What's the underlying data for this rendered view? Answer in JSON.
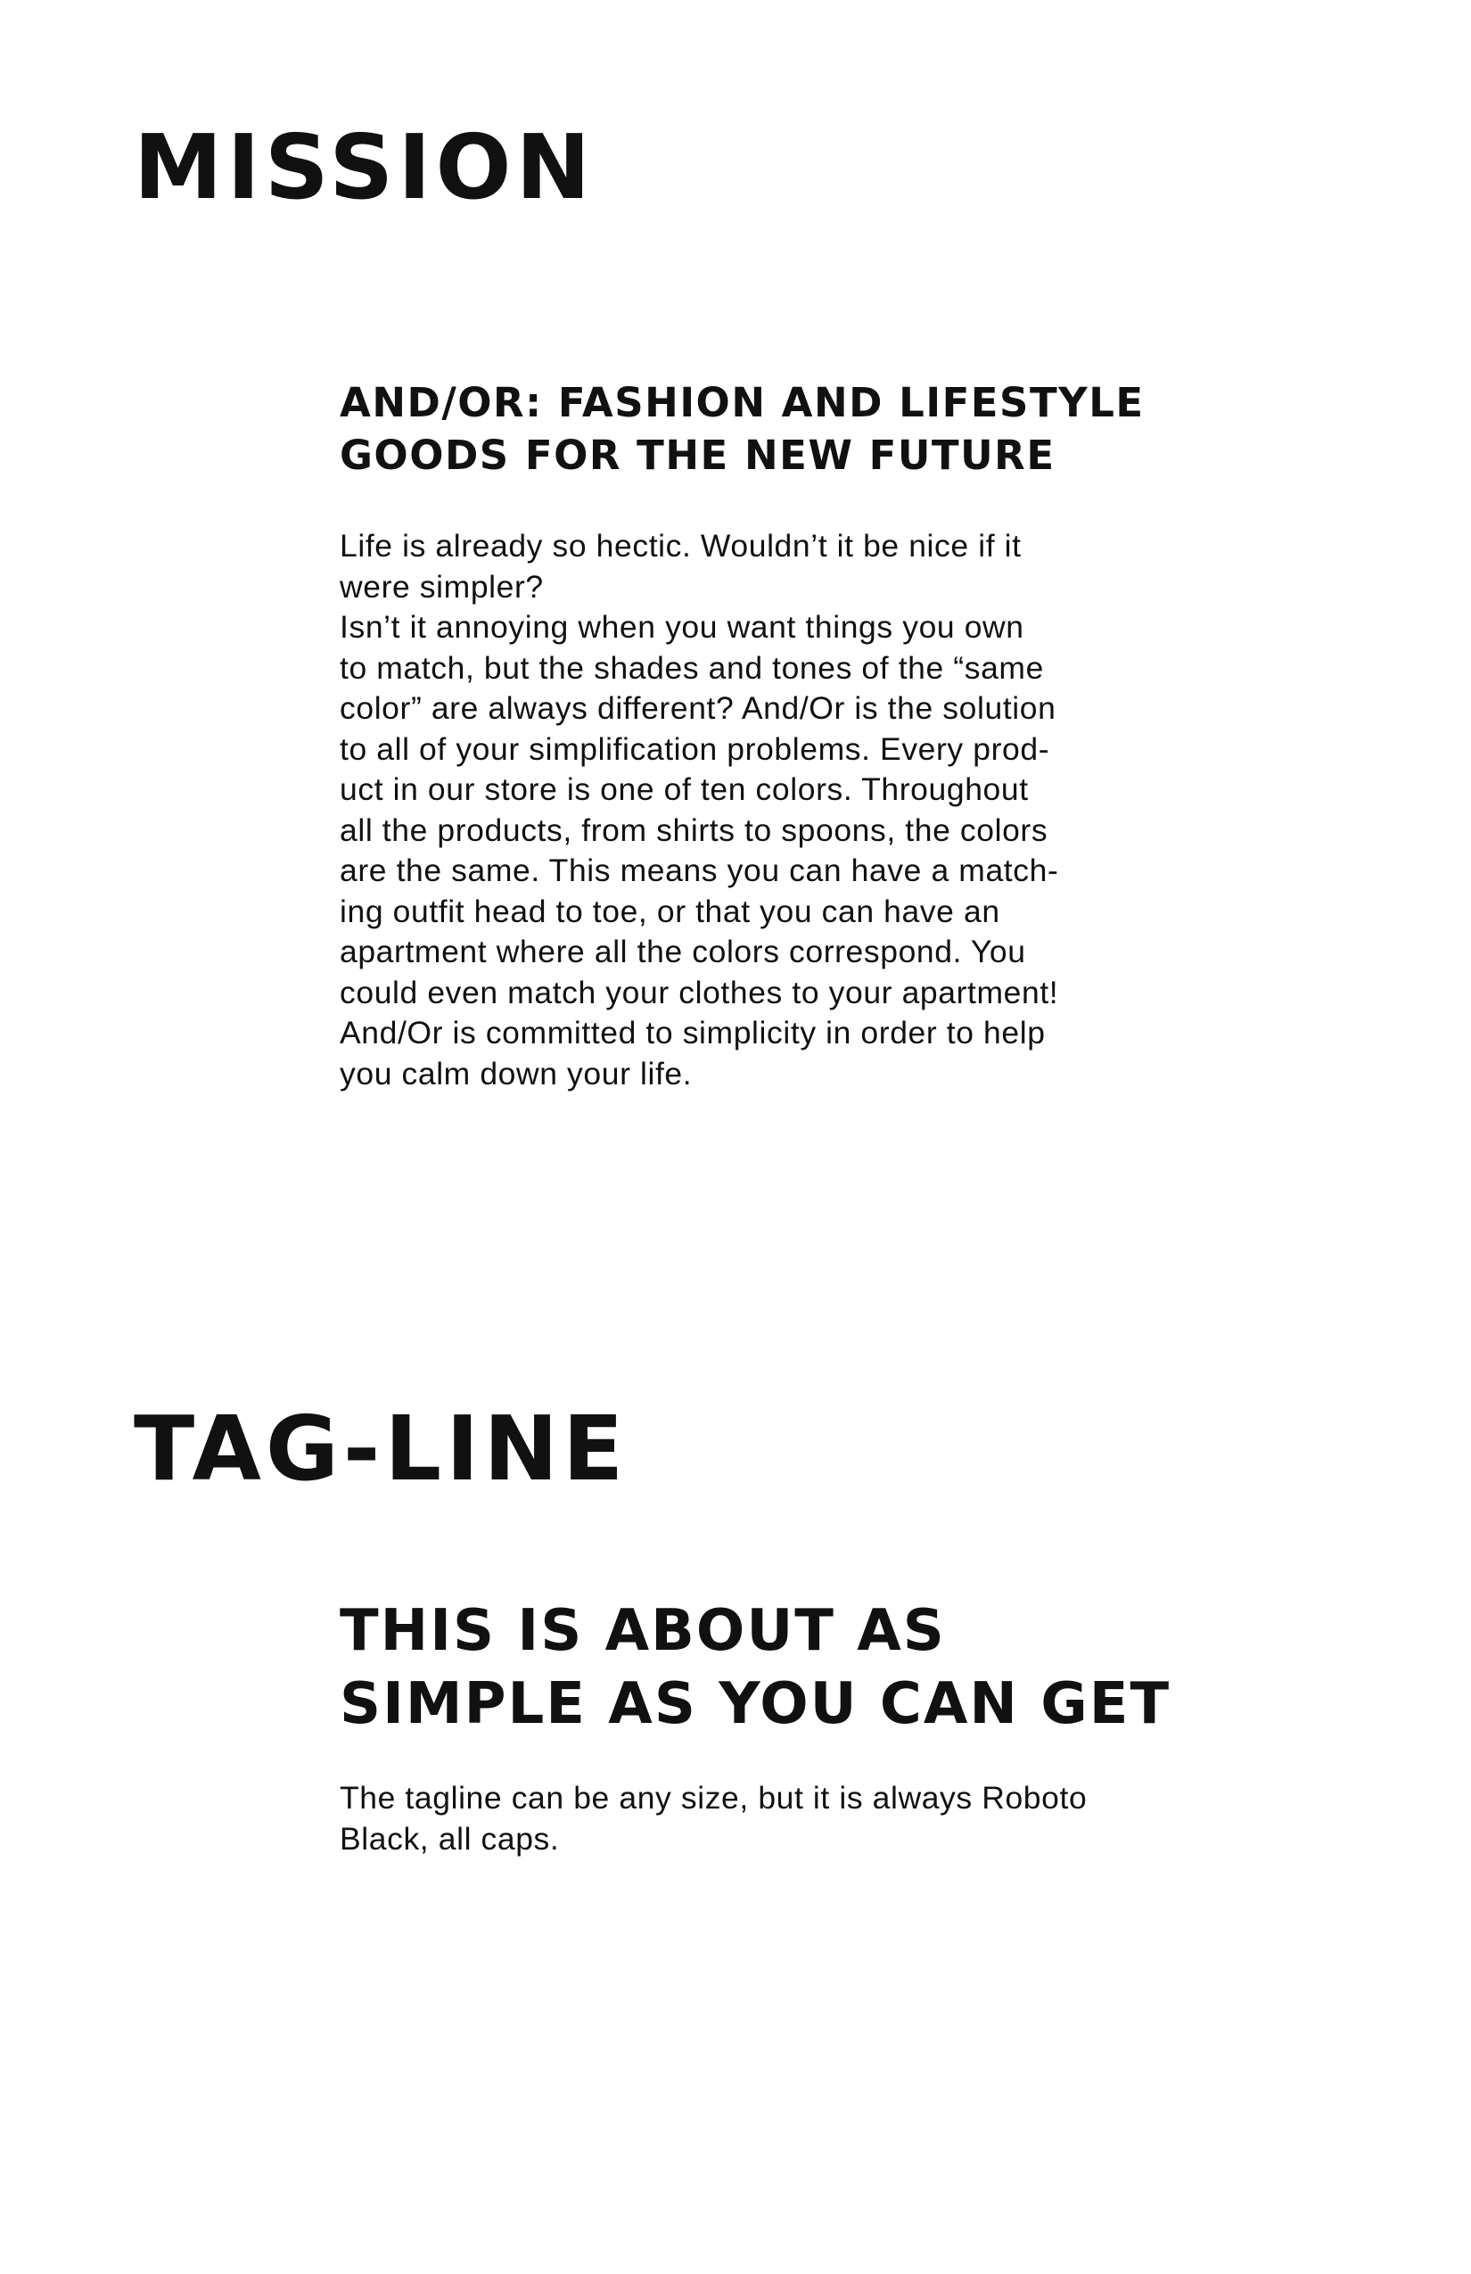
{
  "mission": {
    "title": "MISSION",
    "heading_lines": [
      "AND/OR: FASHION AND LIFESTYLE",
      "GOODS FOR THE NEW FUTURE"
    ],
    "body_lines": [
      "Life is already so hectic. Wouldn’t it be nice if it",
      "were simpler?",
      "Isn’t it annoying when you want things you own",
      "to match, but the shades and tones of the “same",
      "color” are always different? And/Or is the solution",
      "to all of your simplification problems. Every prod-",
      "uct in our store is one of ten colors. Throughout",
      "all the products, from shirts to spoons, the colors",
      "are the same. This means you can have a match-",
      "ing outfit head to toe, or that you can have an",
      "apartment where all the colors correspond. You",
      "could even match your clothes to your apartment!",
      "And/Or is committed to simplicity in order to help",
      "you calm down your life."
    ]
  },
  "tagline": {
    "title": "TAG-LINE",
    "tagline_lines": [
      "THIS IS ABOUT AS",
      "SIMPLE AS YOU CAN GET"
    ],
    "note_lines": [
      "The tagline can be any size, but it is always Roboto",
      "Black, all caps."
    ]
  }
}
